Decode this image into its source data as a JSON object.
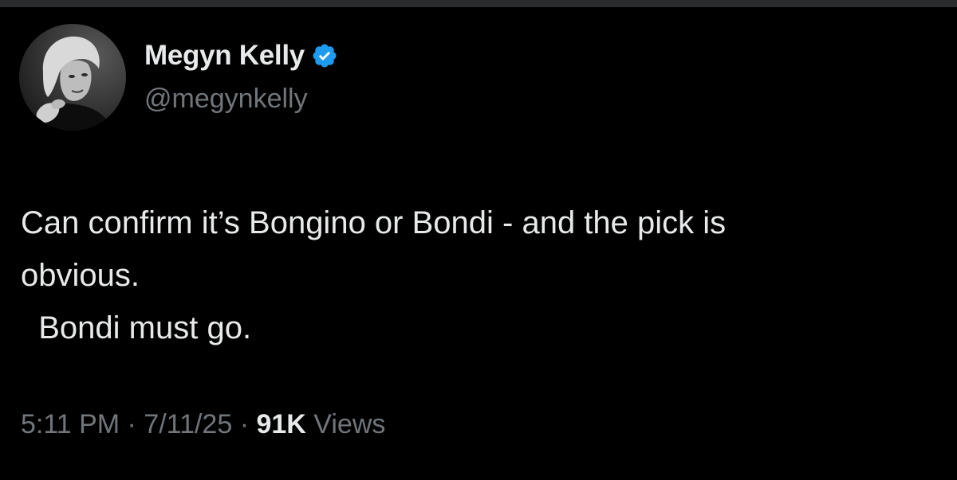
{
  "author": {
    "display_name": "Megyn Kelly",
    "handle": "@megynkelly",
    "verified": true,
    "verified_icon": "verified-badge-icon",
    "avatar": "profile-photo"
  },
  "tweet": {
    "lines": [
      "Can confirm it’s Bongino or Bondi - and the pick is",
      "obvious.",
      "  Bondi must go."
    ]
  },
  "meta": {
    "time": "5:11 PM",
    "separator": " · ",
    "date": "7/11/25",
    "views_count": "91K",
    "views_label": "Views"
  },
  "colors": {
    "background": "#000000",
    "primary_text": "#e7e9ea",
    "secondary_text": "#71767b",
    "verified_blue": "#1d9bf0"
  }
}
